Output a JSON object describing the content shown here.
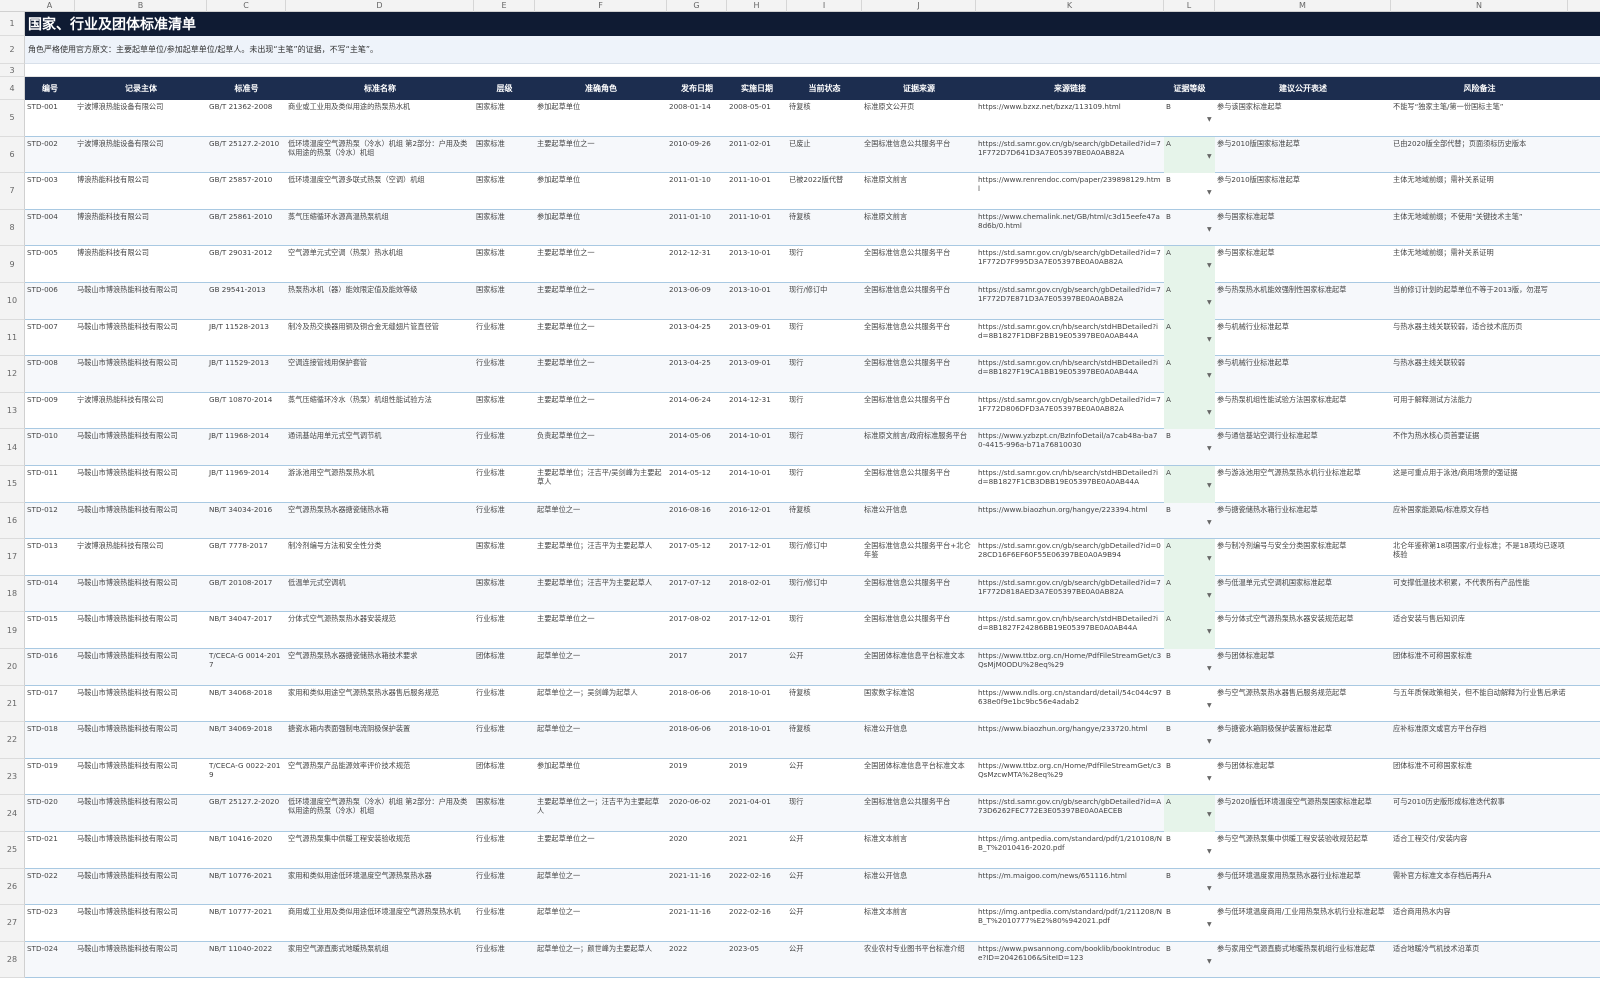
{
  "columns": [
    "A",
    "B",
    "C",
    "D",
    "E",
    "F",
    "G",
    "H",
    "I",
    "J",
    "K",
    "L",
    "M",
    "N"
  ],
  "sheet": {
    "title": "国家、行业及团体标准清单",
    "note": "角色严格使用官方原文：主要起草单位/参加起草单位/起草人。未出现“主笔”的证据，不写“主笔”。"
  },
  "headers": [
    "编号",
    "记录主体",
    "标准号",
    "标准名称",
    "层级",
    "准确角色",
    "发布日期",
    "实施日期",
    "当前状态",
    "证据来源",
    "来源链接",
    "证据等级",
    "建议公开表述",
    "风险备注"
  ],
  "dropdown_glyph": "▼",
  "rows": [
    {
      "n": "5",
      "c": [
        "STD-001",
        "宁波博浪热能设备有限公司",
        "GB/T 21362-2008",
        "商业或工业用及类似用途的热泵热水机",
        "国家标准",
        "参加起草单位",
        "2008-01-14",
        "2008-05-01",
        "待复核",
        "标准原文公开页",
        "https://www.bzxz.net/bzxz/113109.html",
        "B",
        "参与该国家标准起草",
        "不能写“独家主笔/第一份国标主笔”"
      ]
    },
    {
      "n": "6",
      "c": [
        "STD-002",
        "宁波博浪热能设备有限公司",
        "GB/T 25127.2-2010",
        "低环境温度空气源热泵（冷水）机组 第2部分：户用及类似用途的热泵（冷水）机组",
        "国家标准",
        "主要起草单位之一",
        "2010-09-26",
        "2011-02-01",
        "已废止",
        "全国标准信息公共服务平台",
        "https://std.samr.gov.cn/gb/search/gbDetailed?id=71F772D7D641D3A7E05397BE0A0AB82A",
        "A",
        "参与2010版国家标准起草",
        "已由2020版全部代替；页面须标历史版本"
      ]
    },
    {
      "n": "7",
      "c": [
        "STD-003",
        "博浪热能科技有限公司",
        "GB/T 25857-2010",
        "低环境温度空气源多联式热泵（空调）机组",
        "国家标准",
        "参加起草单位",
        "2011-01-10",
        "2011-10-01",
        "已被2022版代替",
        "标准原文前言",
        "https://www.renrendoc.com/paper/239898129.html",
        "B",
        "参与2010版国家标准起草",
        "主体无地域前缀；需补关系证明"
      ]
    },
    {
      "n": "8",
      "c": [
        "STD-004",
        "博浪热能科技有限公司",
        "GB/T 25861-2010",
        "蒸气压缩循环水源高温热泵机组",
        "国家标准",
        "参加起草单位",
        "2011-01-10",
        "2011-10-01",
        "待复核",
        "标准原文前言",
        "https://www.chemalink.net/GB/html/c3d15eefe47a8d6b/0.html",
        "B",
        "参与国家标准起草",
        "主体无地域前缀；不使用“关键技术主笔”"
      ]
    },
    {
      "n": "9",
      "c": [
        "STD-005",
        "博浪热能科技有限公司",
        "GB/T 29031-2012",
        "空气源单元式空调（热泵）热水机组",
        "国家标准",
        "主要起草单位之一",
        "2012-12-31",
        "2013-10-01",
        "现行",
        "全国标准信息公共服务平台",
        "https://std.samr.gov.cn/gb/search/gbDetailed?id=71F772D7F995D3A7E05397BE0A0AB82A",
        "A",
        "参与国家标准起草",
        "主体无地域前缀；需补关系证明"
      ]
    },
    {
      "n": "10",
      "c": [
        "STD-006",
        "马鞍山市博浪热能科技有限公司",
        "GB 29541-2013",
        "热泵热水机（器）能效限定值及能效等级",
        "国家标准",
        "主要起草单位之一",
        "2013-06-09",
        "2013-10-01",
        "现行/修订中",
        "全国标准信息公共服务平台",
        "https://std.samr.gov.cn/gb/search/gbDetailed?id=71F772D7E871D3A7E05397BE0A0AB82A",
        "A",
        "参与热泵热水机能效强制性国家标准起草",
        "当前修订计划的起草单位不等于2013版，勿混写"
      ]
    },
    {
      "n": "11",
      "c": [
        "STD-007",
        "马鞍山市博浪热能科技有限公司",
        "JB/T 11528-2013",
        "制冷及热交换器用铜及铜合金无缝翅片管直径管",
        "行业标准",
        "主要起草单位之一",
        "2013-04-25",
        "2013-09-01",
        "现行",
        "全国标准信息公共服务平台",
        "https://std.samr.gov.cn/hb/search/stdHBDetailed?id=8B1827F1DBF2BB19E05397BE0A0AB44A",
        "A",
        "参与机械行业标准起草",
        "与热水器主线关联较弱，适合技术底历页"
      ]
    },
    {
      "n": "12",
      "c": [
        "STD-008",
        "马鞍山市博浪热能科技有限公司",
        "JB/T 11529-2013",
        "空调连接管线用保护套管",
        "行业标准",
        "主要起草单位之一",
        "2013-04-25",
        "2013-09-01",
        "现行",
        "全国标准信息公共服务平台",
        "https://std.samr.gov.cn/hb/search/stdHBDetailed?id=8B1827F19CA1BB19E05397BE0A0AB44A",
        "A",
        "参与机械行业标准起草",
        "与热水器主线关联较弱"
      ]
    },
    {
      "n": "13",
      "c": [
        "STD-009",
        "宁波博浪热能科技有限公司",
        "GB/T 10870-2014",
        "蒸气压缩循环冷水（热泵）机组性能试验方法",
        "国家标准",
        "主要起草单位之一",
        "2014-06-24",
        "2014-12-31",
        "现行",
        "全国标准信息公共服务平台",
        "https://std.samr.gov.cn/gb/search/gbDetailed?id=71F772D806DFD3A7E05397BE0A0AB82A",
        "A",
        "参与热泵机组性能试验方法国家标准起草",
        "可用于解释测试方法能力"
      ]
    },
    {
      "n": "14",
      "c": [
        "STD-010",
        "马鞍山市博浪热能科技有限公司",
        "JB/T 11968-2014",
        "通讯基站用单元式空气调节机",
        "行业标准",
        "负责起草单位之一",
        "2014-05-06",
        "2014-10-01",
        "现行",
        "标准原文前言/政府标准服务平台",
        "https://www.yzbzpt.cn/BzInfoDetail/a7cab48a-ba70-4415-996a-b71a76810030",
        "B",
        "参与通信基站空调行业标准起草",
        "不作为热水核心页首要证据"
      ]
    },
    {
      "n": "15",
      "c": [
        "STD-011",
        "马鞍山市博浪热能科技有限公司",
        "JB/T 11969-2014",
        "游泳池用空气源热泵热水机",
        "行业标准",
        "主要起草单位；汪吉平/吴剑峰为主要起草人",
        "2014-05-12",
        "2014-10-01",
        "现行",
        "全国标准信息公共服务平台",
        "https://std.samr.gov.cn/hb/search/stdHBDetailed?id=8B1827F1CB3DBB19E05397BE0A0AB44A",
        "A",
        "参与游泳池用空气源热泵热水机行业标准起草",
        "这是可重点用于泳池/商用场景的强证据"
      ]
    },
    {
      "n": "16",
      "c": [
        "STD-012",
        "马鞍山市博浪热能科技有限公司",
        "NB/T 34034-2016",
        "空气源热泵热水器搪瓷储热水箱",
        "行业标准",
        "起草单位之一",
        "2016-08-16",
        "2016-12-01",
        "待复核",
        "标准公开信息",
        "https://www.biaozhun.org/hangye/223394.html",
        "B",
        "参与搪瓷储热水箱行业标准起草",
        "应补国家能源局/标准原文存档"
      ]
    },
    {
      "n": "17",
      "c": [
        "STD-013",
        "宁波博浪热能科技有限公司",
        "GB/T 7778-2017",
        "制冷剂编号方法和安全性分类",
        "国家标准",
        "主要起草单位；汪吉平为主要起草人",
        "2017-05-12",
        "2017-12-01",
        "现行/修订中",
        "全国标准信息公共服务平台+北仑年鉴",
        "https://std.samr.gov.cn/gb/search/gbDetailed?id=028CD16F6EF60F55E06397BE0A0A9B94",
        "A",
        "参与制冷剂编号与安全分类国家标准起草",
        "北仑年鉴称第18项国家/行业标准；不是18项均已逐项核验"
      ]
    },
    {
      "n": "18",
      "c": [
        "STD-014",
        "马鞍山市博浪热能科技有限公司",
        "GB/T 20108-2017",
        "低温单元式空调机",
        "国家标准",
        "主要起草单位；汪吉平为主要起草人",
        "2017-07-12",
        "2018-02-01",
        "现行/修订中",
        "全国标准信息公共服务平台",
        "https://std.samr.gov.cn/gb/search/gbDetailed?id=71F772D818AED3A7E05397BE0A0AB82A",
        "A",
        "参与低温单元式空调机国家标准起草",
        "可支撑低温技术积累，不代表所有产品性能"
      ]
    },
    {
      "n": "19",
      "c": [
        "STD-015",
        "马鞍山市博浪热能科技有限公司",
        "NB/T 34047-2017",
        "分体式空气源热泵热水器安装规范",
        "行业标准",
        "主要起草单位之一",
        "2017-08-02",
        "2017-12-01",
        "现行",
        "全国标准信息公共服务平台",
        "https://std.samr.gov.cn/hb/search/stdHBDetailed?id=8B1827F24286BB19E05397BE0A0AB44A",
        "A",
        "参与分体式空气源热泵热水器安装规范起草",
        "适合安装与售后知识库"
      ]
    },
    {
      "n": "20",
      "c": [
        "STD-016",
        "马鞍山市博浪热能科技有限公司",
        "T/CECA-G 0014-2017",
        "空气源热泵热水器搪瓷储热水箱技术要求",
        "团体标准",
        "起草单位之一",
        "2017",
        "2017",
        "公开",
        "全国团体标准信息平台标准文本",
        "https://www.ttbz.org.cn/Home/PdfFileStreamGet/c3QsMjM0ODU%28eq%29",
        "B",
        "参与团体标准起草",
        "团体标准不可称国家标准"
      ]
    },
    {
      "n": "21",
      "c": [
        "STD-017",
        "马鞍山市博浪热能科技有限公司",
        "NB/T 34068-2018",
        "家用和类似用途空气源热泵热水器售后服务规范",
        "行业标准",
        "起草单位之一；吴剑峰为起草人",
        "2018-06-06",
        "2018-10-01",
        "待复核",
        "国家数字标准馆",
        "https://www.ndls.org.cn/standard/detail/54c044c97638e0f9e1bc9bc56e4adab2",
        "B",
        "参与空气源热泵热水器售后服务规范起草",
        "与五年质保政策相关，但不能自动解释为行业售后承诺"
      ]
    },
    {
      "n": "22",
      "c": [
        "STD-018",
        "马鞍山市博浪热能科技有限公司",
        "NB/T 34069-2018",
        "搪瓷水箱内表面强制电流阴极保护装置",
        "行业标准",
        "起草单位之一",
        "2018-06-06",
        "2018-10-01",
        "待复核",
        "标准公开信息",
        "https://www.biaozhun.org/hangye/233720.html",
        "B",
        "参与搪瓷水箱阴极保护装置标准起草",
        "应补标准原文或官方平台存档"
      ]
    },
    {
      "n": "23",
      "c": [
        "STD-019",
        "马鞍山市博浪热能科技有限公司",
        "T/CECA-G 0022-2019",
        "空气源热泵产品能源效率评价技术规范",
        "团体标准",
        "参加起草单位",
        "2019",
        "2019",
        "公开",
        "全国团体标准信息平台标准文本",
        "https://www.ttbz.org.cn/Home/PdfFileStreamGet/c3QsMzcwMTA%28eq%29",
        "B",
        "参与团体标准起草",
        "团体标准不可称国家标准"
      ]
    },
    {
      "n": "24",
      "c": [
        "STD-020",
        "马鞍山市博浪热能科技有限公司",
        "GB/T 25127.2-2020",
        "低环境温度空气源热泵（冷水）机组 第2部分：户用及类似用途的热泵（冷水）机组",
        "国家标准",
        "主要起草单位之一；汪吉平为主要起草人",
        "2020-06-02",
        "2021-04-01",
        "现行",
        "全国标准信息公共服务平台",
        "https://std.samr.gov.cn/gb/search/gbDetailed?id=A73D6262FEC772E3E05397BE0A0AECEB",
        "A",
        "参与2020版低环境温度空气源热泵国家标准起草",
        "可与2010历史版形成标准迭代叙事"
      ]
    },
    {
      "n": "25",
      "c": [
        "STD-021",
        "马鞍山市博浪热能科技有限公司",
        "NB/T 10416-2020",
        "空气源热泵集中供暖工程安装验收规范",
        "行业标准",
        "主要起草单位之一",
        "2020",
        "2021",
        "公开",
        "标准文本前言",
        "https://img.antpedia.com/standard/pdf/1/210108/NB_T%2010416-2020.pdf",
        "B",
        "参与空气源热泵集中供暖工程安装验收规范起草",
        "适合工程交付/安装内容"
      ]
    },
    {
      "n": "26",
      "c": [
        "STD-022",
        "马鞍山市博浪热能科技有限公司",
        "NB/T 10776-2021",
        "家用和类似用途低环境温度空气源热泵热水器",
        "行业标准",
        "起草单位之一",
        "2021-11-16",
        "2022-02-16",
        "公开",
        "标准公开信息",
        "https://m.maigoo.com/news/651116.html",
        "B",
        "参与低环境温度家用热泵热水器行业标准起草",
        "需补官方标准文本存档后再升A"
      ]
    },
    {
      "n": "27",
      "c": [
        "STD-023",
        "马鞍山市博浪热能科技有限公司",
        "NB/T 10777-2021",
        "商用或工业用及类似用途低环境温度空气源热泵热水机",
        "行业标准",
        "起草单位之一",
        "2021-11-16",
        "2022-02-16",
        "公开",
        "标准文本前言",
        "https://img.antpedia.com/standard/pdf/1/211208/NB_T%2010777%E2%80%942021.pdf",
        "B",
        "参与低环境温度商用/工业用热泵热水机行业标准起草",
        "适合商用热水内容"
      ]
    },
    {
      "n": "28",
      "c": [
        "STD-024",
        "马鞍山市博浪热能科技有限公司",
        "NB/T 11040-2022",
        "家用空气源直膨式地暖热泵机组",
        "行业标准",
        "起草单位之一；颜世峰为主要起草人",
        "2022",
        "2023-05",
        "公开",
        "农业农村专业图书平台标准介绍",
        "https://www.pwsannong.com/booklib/bookIntroduce?ID=20426106&SiteID=123",
        "B",
        "参与家用空气源直膨式地暖热泵机组行业标准起草",
        "适合地暖冷气机技术沿革页"
      ]
    }
  ]
}
